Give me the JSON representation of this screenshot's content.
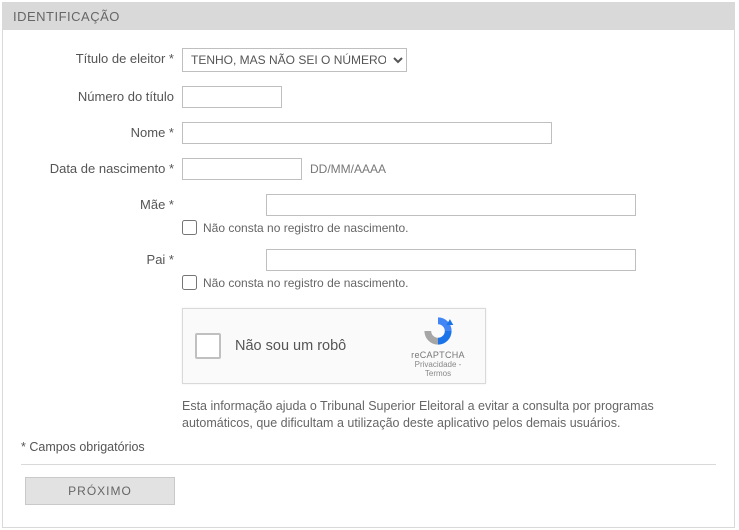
{
  "panel": {
    "title": "IDENTIFICAÇÃO"
  },
  "labels": {
    "titulo_eleitor": "Título de eleitor *",
    "numero_titulo": "Número do título",
    "nome": "Nome *",
    "data_nascimento": "Data de nascimento *",
    "mae": "Mãe *",
    "pai": "Pai *"
  },
  "fields": {
    "titulo_eleitor_selected": "TENHO, MAS NÃO SEI O NÚMERO",
    "numero_titulo_value": "",
    "nome_value": "",
    "data_nascimento_value": "",
    "data_nascimento_hint": "DD/MM/AAAA",
    "mae_value": "",
    "mae_check_label": "Não consta no registro de nascimento.",
    "pai_value": "",
    "pai_check_label": "Não consta no registro de nascimento."
  },
  "captcha": {
    "label": "Não sou um robô",
    "brand": "reCAPTCHA",
    "privacy": "Privacidade",
    "sep": " - ",
    "terms": "Termos"
  },
  "info_text": "Esta informação ajuda o Tribunal Superior Eleitoral a evitar a consulta por programas automáticos, que dificultam a utilização deste aplicativo pelos demais usuários.",
  "required_note": "* Campos obrigatórios",
  "buttons": {
    "next": "PRÓXIMO"
  }
}
